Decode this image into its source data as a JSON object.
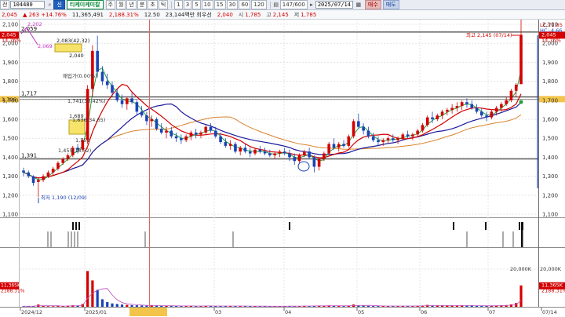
{
  "toolbar": {
    "menu_label": "전",
    "code_value": "104480",
    "stock_name": "티케이케미칼",
    "chart_type_label": "신",
    "periods": [
      "주",
      "월",
      "년",
      "분",
      "초",
      "틱"
    ],
    "intervals": [
      "1",
      "3",
      "5",
      "10",
      "15",
      "30",
      "60",
      "120"
    ],
    "count_display": "147/600",
    "date_value": "2025/07/14",
    "buy_label": "매수",
    "sell_label": "매도"
  },
  "quote": {
    "price": "2,045",
    "change": "263 +14.76%",
    "volume": "11,365,491",
    "value": "2,188.31%",
    "ratio": "12.50",
    "trade_amount": "23,144백만",
    "trade_label": "회우선",
    "open": "2,040",
    "high_label": "시",
    "high": "1,785",
    "low_label": "고",
    "low": "2,145",
    "close_label": "저",
    "close": "1,785"
  },
  "price_axis": {
    "ticks": [
      "2,100",
      "2,000",
      "1,900",
      "1,800",
      "1,700",
      "1,600",
      "1,500",
      "1,400",
      "1,300",
      "1,200",
      "1,100"
    ],
    "right_ticks": [
      "2,100",
      "2,000",
      "1,900",
      "1,800",
      "1,700",
      "1,600",
      "1,500",
      "1,400",
      "1,300",
      "1,200",
      "1,100"
    ],
    "current_price_tag": "2,045",
    "current_change_tag": "14.76%",
    "left_current_tag": "2,045",
    "left_change_tag": "14.76%",
    "lc_label": "LC:71.85",
    "hc_label": "HC:-4.66",
    "level_1717": "1,717",
    "level_1706": "1,706",
    "level_1391": "1,391",
    "level_2059": "2,059"
  },
  "annotations": {
    "high_note": "최고 2,145 (07/14)",
    "low_note": "최저 1,190 (12/09)",
    "top_left_2202": "2,202",
    "top_left_2069": "2,069",
    "box_2083": "2,083(42.32)",
    "label_2040": "2,040",
    "label_buy_point": "매입가(0.00%)",
    "label_1741": "1,741(30.42%)",
    "label_1689": "1,689",
    "label_1636": "1,636(34.65)",
    "label_1551": "1,551",
    "label_1455": "1,455(18.52)"
  },
  "volume_axis": {
    "tick": "20,000K",
    "current_tag": "11,365K",
    "pct_tag": "2188.31%",
    "left_current_tag": "11,365K",
    "left_pct_tag": "2188.31%"
  },
  "date_axis": [
    "2024/12",
    "2025/01",
    "03",
    "04",
    "05",
    "06",
    "07",
    "07/14"
  ],
  "colors": {
    "up": "#d40000",
    "down": "#1a43b8",
    "ma5": "#1fa23a",
    "ma20": "#d40000",
    "ma60": "#1a1a9a",
    "ma120": "#d9822b"
  }
}
